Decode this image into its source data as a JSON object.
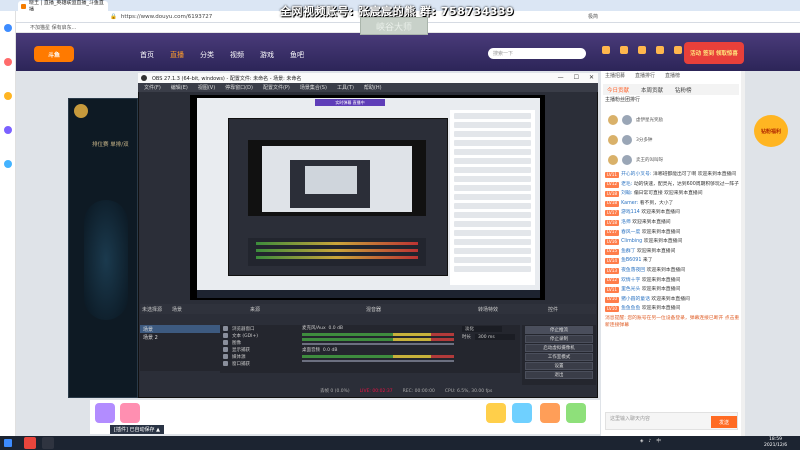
{
  "browser": {
    "tab_title": "晓王 | 直播_英雄联盟直播_斗鱼直播",
    "url": "https://www.douyu.com/6193727",
    "extension_label": "极简",
    "bookmark": "不加猫星 保有启东..."
  },
  "watermark": {
    "line1": "全网视频账号: 张宸宸的熊  群: 758734339",
    "badge": "峡谷大师"
  },
  "douyu": {
    "logo": "斗鱼",
    "nav": [
      "首页",
      "直播",
      "分类",
      "视频",
      "游戏",
      "鱼吧"
    ],
    "search_placeholder": "搜索一下",
    "header_icons": [
      "主播",
      "充值",
      "消息",
      "任务",
      "签到"
    ],
    "banner": "活动 签到 领取惊喜"
  },
  "game": {
    "title": "排位赛 单排/双"
  },
  "obs": {
    "title": "OBS 27.1.3 (64-bit, windows) - 配置文件: 未命名 - 场景: 未命名",
    "menu": [
      "文件(F)",
      "编辑(E)",
      "视图(V)",
      "停靠窗口(D)",
      "配置文件(P)",
      "场景集合(S)",
      "工具(T)",
      "帮助(H)"
    ],
    "inner_banner": "实时弹幕 直播中",
    "dock_titles": {
      "scenes": "场景",
      "sources": "来源",
      "mixer": "混音器",
      "transitions": "转场特效",
      "controls": "控件",
      "no_source": "未选择源"
    },
    "scenes": [
      "场景",
      "场景 2"
    ],
    "sources": [
      "浏览器窗口",
      "文本 (GDI+)",
      "图像",
      "显示捕获",
      "媒体源",
      "窗口捕获"
    ],
    "mixer": [
      {
        "name": "麦克风/Aux",
        "db": "0.0 dB"
      },
      {
        "name": "桌面音频",
        "db": "0.0 dB"
      }
    ],
    "transition": {
      "name": "淡化",
      "duration_label": "时长",
      "duration": "300 ms"
    },
    "controls": [
      "停止推流",
      "停止录制",
      "启动虚拟摄像机",
      "工作室模式",
      "设置",
      "退出"
    ],
    "status": {
      "dropped": "丢帧 0 (0.0%)",
      "live": "LIVE: 00:02:37",
      "rec": "REC: 00:00:00",
      "cpu": "CPU: 6.5%, 30.00 fps"
    }
  },
  "chat": {
    "head": [
      "主播招募",
      "直播排行",
      "直播榜"
    ],
    "tabs": [
      "今日贡献",
      "本周贡献",
      "钻粉榜"
    ],
    "rank_title": "主播粉丝团排行",
    "rank_users": [
      "虚伊星光奖励",
      "3分多钟",
      "卖王的叫叫呀"
    ],
    "lines": [
      {
        "lv": "LV11",
        "name": "开心的小叉号:",
        "text": "洋哪班都能出可了啊 欢迎来到本直播间"
      },
      {
        "lv": "LV12",
        "name": "老毛:",
        "text": "动的快速，配灵光，达到600周期积够玩过一阵子"
      },
      {
        "lv": "LV18",
        "name": "刘翰:",
        "text": "偏日常可直接 欢迎来到本直播间"
      },
      {
        "lv": "LV18",
        "name": "Kamer:",
        "text": "看不到，大小了"
      },
      {
        "lv": "LV17",
        "name": "游戏114",
        "text": "欢迎来到本直播间"
      },
      {
        "lv": "LV18",
        "name": "洛师",
        "text": "欢迎来到本直播间"
      },
      {
        "lv": "LV17",
        "name": "春风一度",
        "text": "欢迎来到本直播间"
      },
      {
        "lv": "LV16",
        "name": "Climbing",
        "text": "欢迎来到本直播间"
      },
      {
        "lv": "LV15",
        "name": "鱼群丁",
        "text": "欢迎来到本直播间"
      },
      {
        "lv": "LV14",
        "name": "鱼B6091",
        "text": "来了"
      },
      {
        "lv": "LV13",
        "name": "夜鱼落夜回",
        "text": "欢迎来到本直播间"
      },
      {
        "lv": "LV12",
        "name": "欢情十字",
        "text": "欢迎来到本直播间"
      },
      {
        "lv": "LV11",
        "name": "里色光头",
        "text": "欢迎来到本直播间"
      },
      {
        "lv": "LV10",
        "name": "猪小圆的童话",
        "text": "欢迎来到本直播间"
      },
      {
        "lv": "LV10",
        "name": "鱼鱼鱼鱼",
        "text": "欢迎来到本直播间"
      },
      {
        "lv": "",
        "name": "消息提醒:",
        "text": "您的账号在另一位设备登录，弹幕连接已断开 点击重新连接弹幕"
      }
    ],
    "input_placeholder": "这里输入聊天内容",
    "send": "发送",
    "promo": "钻粉福利"
  },
  "taskbar": {
    "download_toast": "[插件] 已自动保存 ▲",
    "time": "18:59",
    "date": "2021/12/6"
  }
}
